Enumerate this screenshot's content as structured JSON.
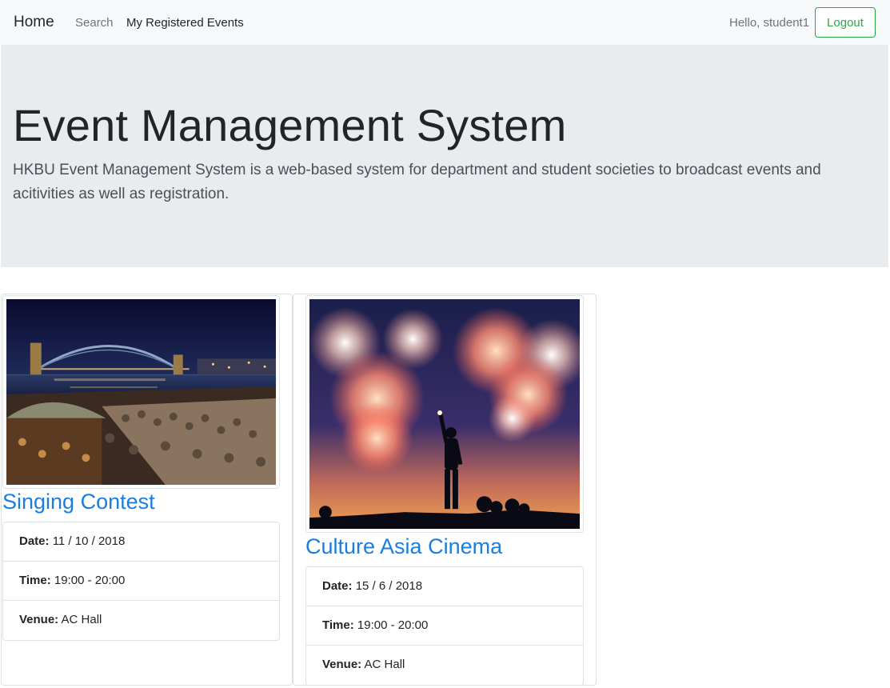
{
  "navbar": {
    "brand": "Home",
    "links": {
      "search": "Search",
      "registered": "My Registered Events"
    },
    "greeting": "Hello, student1",
    "logout_label": "Logout"
  },
  "jumbotron": {
    "title": "Event Management System",
    "lead": "HKBU Event Management System is a web-based system for department and student societies to broadcast events and acitivities as well as registration."
  },
  "events": [
    {
      "title": "Singing Contest",
      "image": "harbour-bridge-night-crowd",
      "date_label": "Date:",
      "date": "11 / 10 / 2018",
      "time_label": "Time:",
      "time": "19:00 - 20:00",
      "venue_label": "Venue:",
      "venue": "AC Hall"
    },
    {
      "title": "Culture Asia Cinema",
      "image": "fireworks-silhouette",
      "date_label": "Date:",
      "date": "15 / 6 / 2018",
      "time_label": "Time:",
      "time": "19:00 - 20:00",
      "venue_label": "Venue:",
      "venue": "AC Hall"
    }
  ],
  "colors": {
    "navbar_bg": "#f8f9fa",
    "jumbotron_bg": "#e9ecef",
    "link_blue": "#1a7ee0",
    "logout_green": "#28a745"
  }
}
